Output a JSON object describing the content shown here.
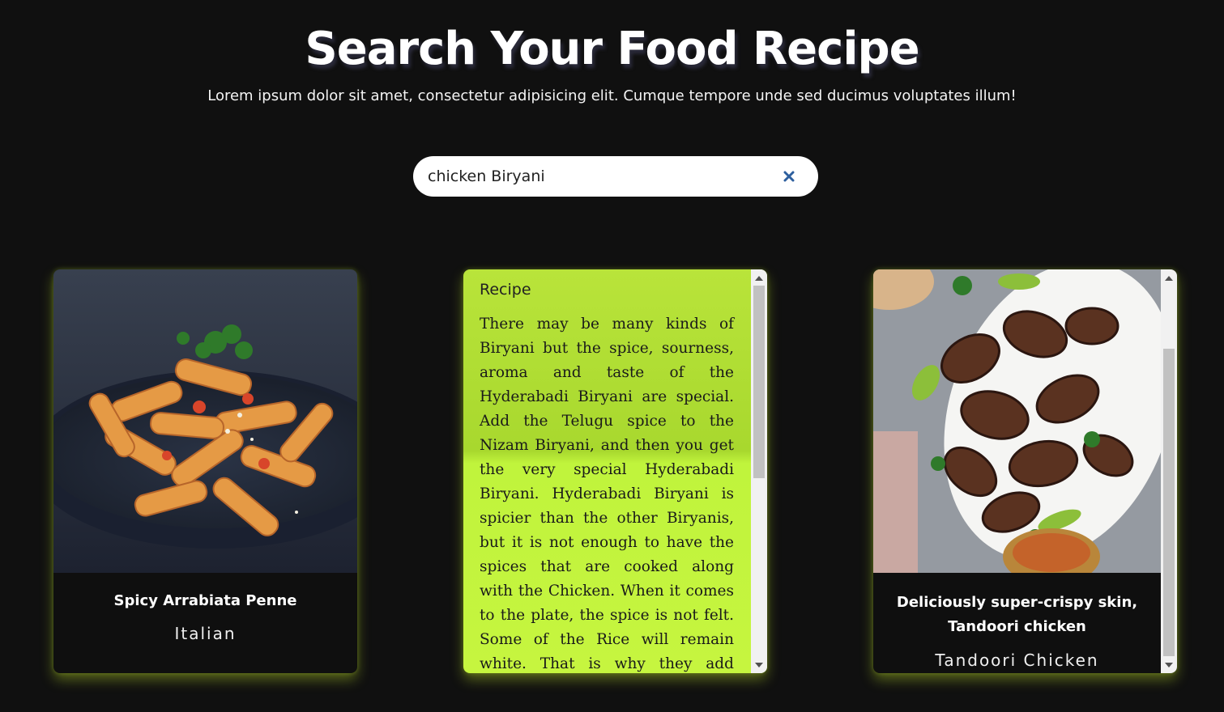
{
  "header": {
    "title": "Search Your Food Recipe",
    "subtitle": "Lorem ipsum dolor sit amet, consectetur adipisicing elit. Cumque tempore unde sed ducimus voluptates illum!"
  },
  "search": {
    "value": "chicken Biryani",
    "clear_icon": "close-icon"
  },
  "cards": [
    {
      "name": "Spicy Arrabiata Penne",
      "cuisine": "Italian",
      "image": "penne-pasta-photo"
    },
    {
      "recipe_label": "Recipe",
      "recipe_text": "There may be many kinds of Biryani but the spice, sourness, aroma and taste of the Hyderabadi Biryani are special. Add the Telugu spice to the Nizam Biryani, and then you get the very special Hyderabadi Biryani. Hyderabadi Biryani is spicier than the other Biryanis, but it is not enough to have the spices that are cooked along with the Chicken. When it comes to the plate, the spice is not felt. Some of the Rice will remain white. That is why they add Mirchi ka Salan and satisfy themselves."
    },
    {
      "name": "Deliciously super-crispy skin, Tandoori chicken",
      "cuisine": "Tandoori Chicken",
      "image": "tandoori-chicken-photo"
    }
  ],
  "colors": {
    "background": "#101010",
    "accent_green": "#c6f53f",
    "clear_icon": "#2d5f9e"
  }
}
